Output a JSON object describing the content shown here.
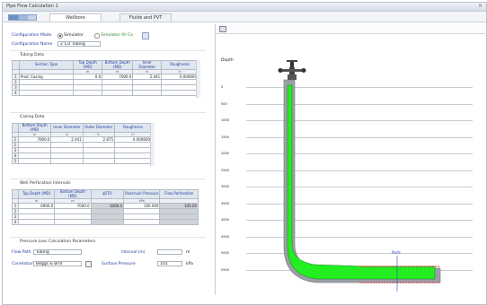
{
  "window": {
    "title": "Pipe Flow Calculation 1",
    "close_glyph": "×"
  },
  "tabs": [
    {
      "label": "Wellbore"
    },
    {
      "label": "Fluids and PVT"
    }
  ],
  "config": {
    "row1_label": "Configuration Mode",
    "radio_a": "Simulator",
    "radio_b": "Simulator All Co",
    "row2_label": "Configuration Name",
    "name_value": "2 1/2 Tubing"
  },
  "tubing": {
    "title": "Tubing Data",
    "headers": [
      "Section Type",
      "Top Depth (MD)",
      "Bottom Depth (MD)",
      "Inner Diameter",
      "Roughness"
    ],
    "units": [
      "",
      "m",
      "m",
      "in",
      "in"
    ],
    "rows": [
      {
        "n": "1",
        "cells": [
          "Prod. Casing",
          "0.0",
          "7000.0",
          "2.441",
          "0.000600"
        ]
      },
      {
        "n": "2",
        "cells": [
          "",
          "",
          "",
          "",
          ""
        ]
      },
      {
        "n": "3",
        "cells": [
          "",
          "",
          "",
          "",
          ""
        ]
      },
      {
        "n": "4",
        "cells": [
          "",
          "",
          "",
          "",
          ""
        ]
      }
    ]
  },
  "casing": {
    "title": "Casing Data",
    "headers": [
      "Bottom Depth (MD)",
      "Inner Diameter",
      "Outer Diameter",
      "Roughness"
    ],
    "units": [
      "m",
      "in",
      "in",
      "in"
    ],
    "rows": [
      {
        "n": "1",
        "cells": [
          "7000.0",
          "2.441",
          "2.875",
          "0.000600"
        ]
      },
      {
        "n": "2",
        "cells": [
          "",
          "",
          "",
          ""
        ]
      },
      {
        "n": "3",
        "cells": [
          "",
          "",
          "",
          ""
        ]
      },
      {
        "n": "4",
        "cells": [
          "",
          "",
          "",
          ""
        ]
      },
      {
        "n": "5",
        "cells": [
          "",
          "",
          "",
          ""
        ]
      }
    ]
  },
  "perf": {
    "title": "Well Perforation Intervals",
    "headers": [
      "Top Depth (MD)",
      "Bottom Depth (MD)",
      "qSTO",
      "Reservoir Pressure",
      "Flow Perforation"
    ],
    "units": [
      "m",
      "m",
      "",
      "kPa",
      ""
    ],
    "rows": [
      {
        "n": "1",
        "cells": [
          "6900.0",
          "7000.0",
          "1000.0",
          "100.000",
          "100.00"
        ]
      },
      {
        "n": "2",
        "cells": [
          "",
          "",
          "",
          "",
          ""
        ]
      },
      {
        "n": "3",
        "cells": [
          "",
          "",
          "",
          "",
          ""
        ]
      },
      {
        "n": "4",
        "cells": [
          "",
          "",
          "",
          "",
          ""
        ]
      }
    ]
  },
  "pressure": {
    "title": "Pressure Loss Calculation Parameters",
    "flow_path_label": "Flow Path",
    "flow_path_value": "Tubing",
    "correlation_label": "Correlation",
    "correlation_value": "Beggs & Brill",
    "right1_label": "Interval (m)",
    "right1_value": "",
    "right1_unit": "m",
    "right2_label": "Surface Pressure",
    "right2_value": "101",
    "right2_unit": "kPa"
  },
  "plot": {
    "header_text": "",
    "y_axis_title": "Depth",
    "y_ticks": [
      "0",
      "500",
      "1000",
      "1500",
      "2000",
      "2500",
      "3000",
      "3500",
      "4000",
      "4500",
      "5000",
      "5500"
    ],
    "annotation": "Perfs",
    "tubing_color": "#22ee22"
  }
}
